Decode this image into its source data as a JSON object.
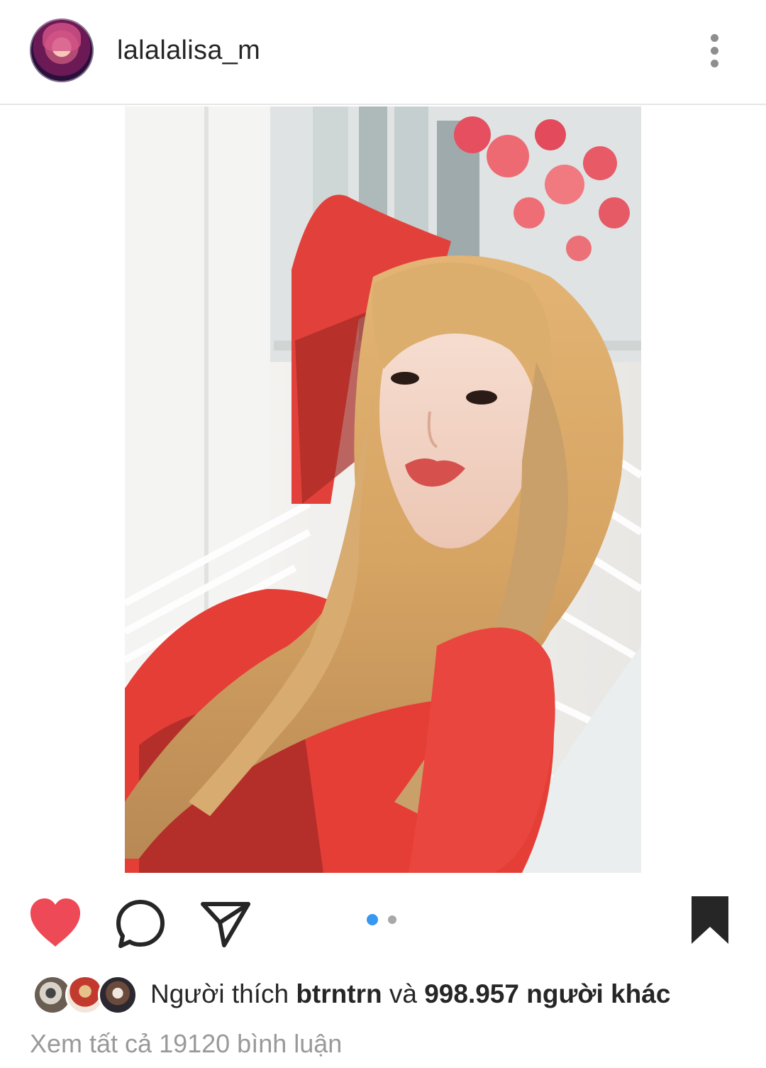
{
  "header": {
    "username": "lalalalisa_m",
    "more_icon": "more-vertical-icon"
  },
  "post": {
    "carousel_current": 1,
    "carousel_total": 2
  },
  "actions": {
    "like_icon": "heart-filled-icon",
    "comment_icon": "comment-bubble-icon",
    "share_icon": "paper-plane-icon",
    "save_icon": "bookmark-filled-icon",
    "like_color": "#ed4956",
    "accent_color": "#3897f0"
  },
  "likes": {
    "prefix": "Người thích",
    "liker": "btrntrn",
    "conjunction": "và",
    "others": "998.957 người khác"
  },
  "comments": {
    "view_all": "Xem tất cả 19120 bình luận"
  }
}
